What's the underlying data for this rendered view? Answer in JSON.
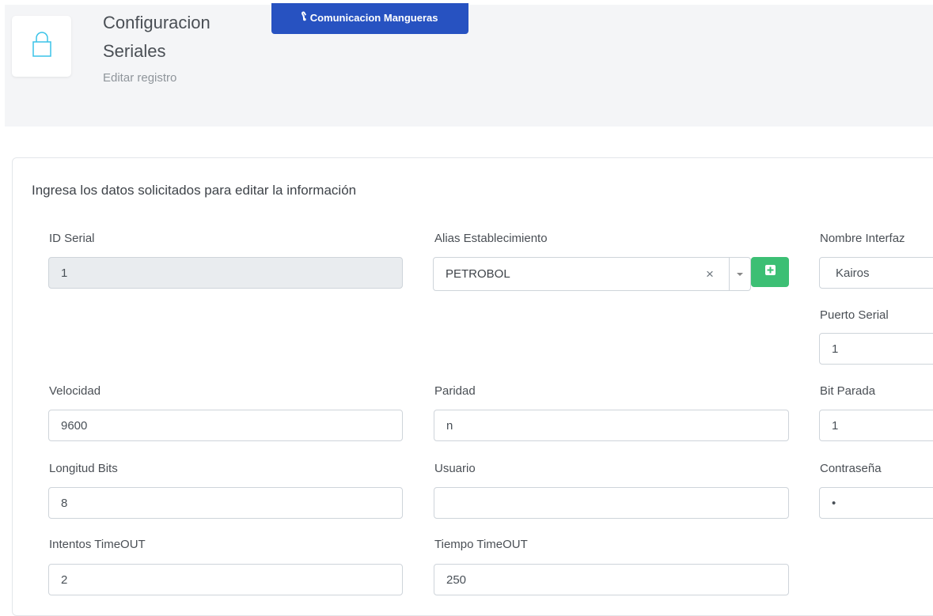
{
  "header": {
    "title": "Configuracion Seriales",
    "subtitle": "Editar registro",
    "button_label": "Comunicacion Mangueras",
    "icon": "lock-icon",
    "button_icon": "hoses-icon"
  },
  "form": {
    "instructions": "Ingresa los datos solicitados para editar la información",
    "fields": {
      "id_serial": {
        "label": "ID Serial",
        "value": "1"
      },
      "alias": {
        "label": "Alias Establecimiento",
        "value": "PETROBOL",
        "clear": "×"
      },
      "interface": {
        "label": "Nombre Interfaz",
        "value": "Kairos"
      },
      "port": {
        "label": "Puerto Serial",
        "value": "1"
      },
      "speed": {
        "label": "Velocidad",
        "value": "9600"
      },
      "parity": {
        "label": "Paridad",
        "value": "n"
      },
      "stop_bit": {
        "label": "Bit Parada",
        "value": "1"
      },
      "bits_length": {
        "label": "Longitud Bits",
        "value": "8"
      },
      "user": {
        "label": "Usuario",
        "value": ""
      },
      "password": {
        "label": "Contraseña",
        "value": "•"
      },
      "timeout_attempts": {
        "label": "Intentos TimeOUT",
        "value": "2"
      },
      "timeout_time": {
        "label": "Tiempo TimeOUT",
        "value": "250"
      }
    }
  },
  "colors": {
    "primary_button": "#2752c1",
    "success_button": "#3cbf74",
    "icon_accent": "#3ac3e8"
  }
}
